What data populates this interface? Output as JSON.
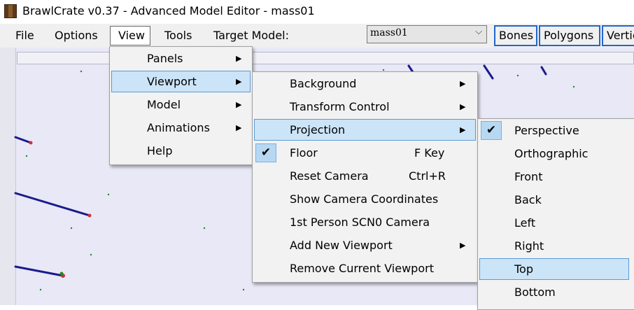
{
  "window": {
    "title": "BrawlCrate v0.37 - Advanced Model Editor - mass01"
  },
  "menubar": {
    "file": "File",
    "options": "Options",
    "view": "View",
    "tools": "Tools",
    "target_model_label": "Target Model:",
    "target_model_value": "mass01"
  },
  "toolbar": {
    "bones": "Bones",
    "polygons": "Polygons",
    "vertices": "Vertices"
  },
  "view_menu": {
    "items": [
      "Panels",
      "Viewport",
      "Model",
      "Animations",
      "Help"
    ]
  },
  "viewport_menu": {
    "items": [
      {
        "label": "Background",
        "shortcut": ""
      },
      {
        "label": "Transform Control",
        "shortcut": ""
      },
      {
        "label": "Projection",
        "shortcut": ""
      },
      {
        "label": "Floor",
        "shortcut": "F Key",
        "checked": true
      },
      {
        "label": "Reset Camera",
        "shortcut": "Ctrl+R"
      },
      {
        "label": "Show Camera Coordinates",
        "shortcut": ""
      },
      {
        "label": "1st Person SCN0 Camera",
        "shortcut": ""
      },
      {
        "label": "Add New Viewport",
        "shortcut": ""
      },
      {
        "label": "Remove Current Viewport",
        "shortcut": ""
      }
    ]
  },
  "projection_menu": {
    "items": [
      {
        "label": "Perspective",
        "checked": true
      },
      {
        "label": "Orthographic"
      },
      {
        "label": "Front"
      },
      {
        "label": "Back"
      },
      {
        "label": "Left"
      },
      {
        "label": "Right"
      },
      {
        "label": "Top"
      },
      {
        "label": "Bottom"
      }
    ]
  },
  "icons": {
    "check": "✔",
    "submenu_arrow": "▶",
    "dropdown_arrow": "⌵"
  },
  "colors": {
    "viewport_bg": "#e8e8f6",
    "menu_bg": "#f2f2f2",
    "highlight_bg": "#cce4f7",
    "highlight_border": "#5a9bd5",
    "toolbar_button_border": "#2266cc",
    "bone_line": "#1a1a8c"
  }
}
